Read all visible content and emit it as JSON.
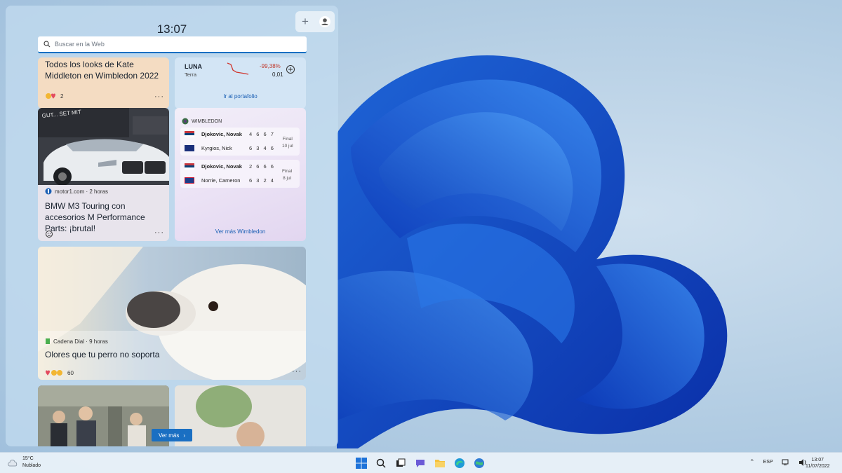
{
  "panel": {
    "time": "13:07",
    "search_placeholder": "Buscar en la Web"
  },
  "cards": {
    "news1": {
      "title": "Todos los looks de Kate Middleton en Wimbledon 2022",
      "reactions": "2"
    },
    "portfolio": {
      "symbol": "LUNA",
      "name": "Terra",
      "change": "-99,38%",
      "price": "0,01",
      "link": "Ir al portafolio"
    },
    "bmw": {
      "source": "motor1.com · 2 horas",
      "title": "BMW M3 Touring con accesorios M Performance Parts: ¡brutal!"
    },
    "wimbledon": {
      "header": "WIMBLEDON",
      "match1": {
        "p1": "Djokovic, Novak",
        "s1": "4 6 6 7",
        "p2": "Kyrgios, Nick",
        "s2": "6 3 4 6",
        "status": "Final",
        "date": "10 jul"
      },
      "match2": {
        "p1": "Djokovic, Novak",
        "s1": "2 6 6 6",
        "p2": "Norrie, Cameron",
        "s2": "6 3 2 4",
        "status": "Final",
        "date": "8 jul"
      },
      "link": "Ver más Wimbledon"
    },
    "dog": {
      "source": "Cadena Dial · 9 horas",
      "title": "Olores que tu perro no soporta",
      "reactions": "60"
    },
    "ver_mas": "Ver más"
  },
  "taskbar": {
    "temp": "15°C",
    "condition": "Nublado",
    "lang": "ESP",
    "time": "13:07",
    "date": "11/07/2022"
  },
  "colors": {
    "accent": "#0a6fc2",
    "negative": "#c0392b"
  }
}
